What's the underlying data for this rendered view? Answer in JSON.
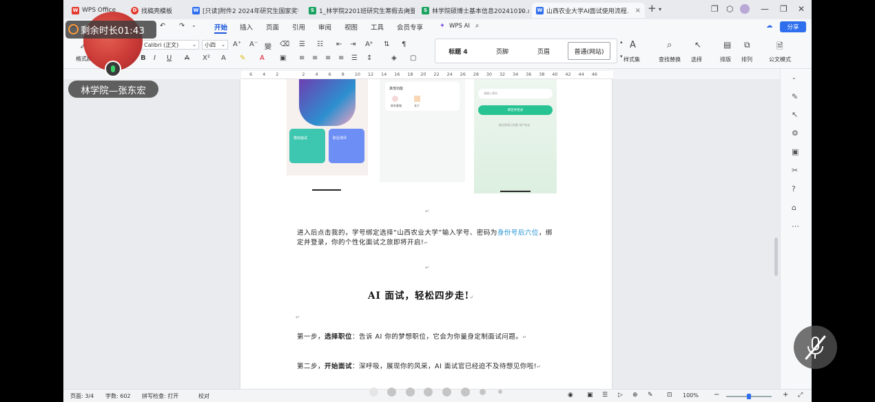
{
  "tabs": [
    {
      "label": "WPS Office",
      "icon": "wps-logo-icon",
      "color": "#e33b2f"
    },
    {
      "label": "找稿壳模板",
      "icon": "template-icon",
      "color": "#e33b2f"
    },
    {
      "label": "[只读]附件2 2024年研究生国家奖学金",
      "icon": "word-doc-icon",
      "color": "#2f6fed"
    },
    {
      "label": "1_林学院2201班研究生寒假去向登",
      "icon": "sheet-icon",
      "color": "#1aa260"
    },
    {
      "label": "林学院硕博士基本信息20241010.x",
      "icon": "sheet-icon",
      "color": "#1aa260"
    },
    {
      "label": "山西农业大学AI面试使用流程.",
      "icon": "word-doc-icon",
      "color": "#2f6fed"
    }
  ],
  "menu": [
    "开始",
    "插入",
    "页面",
    "引用",
    "审阅",
    "视图",
    "工具",
    "会员专享"
  ],
  "menu_extra": {
    "wps_ai": "WPS AI",
    "share": "分享"
  },
  "ribbon": {
    "format_painter": "格式刷",
    "font_name": "Calibri (正文)",
    "font_size": "小四",
    "styles": [
      "标题 4",
      "页脚",
      "页眉",
      "普通(网站)"
    ],
    "style_set": "样式集",
    "find_replace": "查找替换",
    "select": "选择",
    "layout": "排版",
    "arrange": "排列",
    "official_mode": "公文模式"
  },
  "ruler_numbers": [
    "6",
    "4",
    "2",
    "",
    "2",
    "4",
    "6",
    "8",
    "10",
    "12",
    "14",
    "16",
    "18",
    "20",
    "22",
    "24",
    "26",
    "28",
    "30",
    "32",
    "34",
    "36",
    "38",
    "40",
    "42",
    "44",
    "46"
  ],
  "doc": {
    "para1_a": "进入后点击我的，学号绑定选择“山西农业大学”输入学号、密码为",
    "para1_link": "身份号后六位",
    "para1_b": "，绑定并登录，你的个性化面试之旅即将开启!",
    "heading": "AI 面试，轻松四步走!",
    "step1_a": "第一步，",
    "step1_b": "选择职位",
    "step1_c": "：告诉 AI 你的梦想职位，它会为你量身定制面试问题。",
    "step2_a": "第二步，",
    "step2_b": "开始面试",
    "step2_c": "：深呼吸，展现你的风采，AI 面试官已经迫不及待想见你啦!",
    "phone1": {
      "card1": "模拟面试",
      "card2": "职业测评"
    },
    "phone2": {
      "title": "其他功能",
      "item1": "联系客服",
      "item2": "关于"
    },
    "phone3": {
      "placeholder": "请输入密码",
      "button": "绑定并登录",
      "hint": "绑定即表示同意 用户协议"
    }
  },
  "status": {
    "page": "页面: 3/4",
    "words": "字数: 602",
    "spell": "拼写检查: 打开",
    "proof": "校对",
    "zoom": "100%"
  },
  "overlay": {
    "timer": "剩余时长01:43",
    "name": "林学院—张东宏"
  }
}
